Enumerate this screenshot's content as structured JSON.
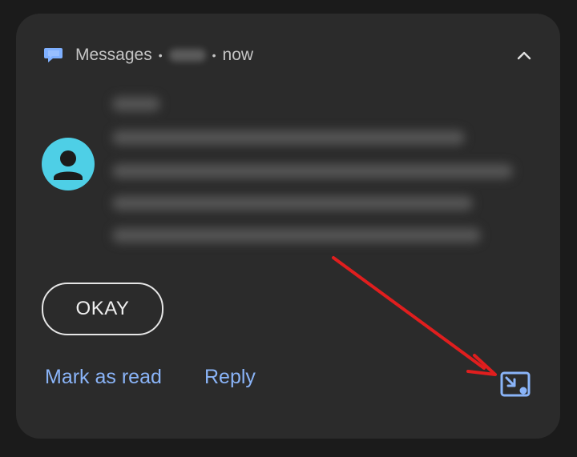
{
  "notification": {
    "app_name": "Messages",
    "separator": "•",
    "time": "now",
    "app_icon": "messages-bubble-icon",
    "collapse_icon": "chevron-up-icon",
    "avatar_icon": "person-icon",
    "reply_action": "OKAY",
    "actions": {
      "mark_as_read": "Mark as read",
      "reply": "Reply"
    },
    "popout_icon": "picture-in-picture-bubble-icon"
  },
  "colors": {
    "background": "#1b1b1b",
    "card": "#2b2b2b",
    "accent_blue": "#8ab4f8",
    "avatar": "#4ecfe6",
    "annotation_arrow": "#e01e1e"
  }
}
